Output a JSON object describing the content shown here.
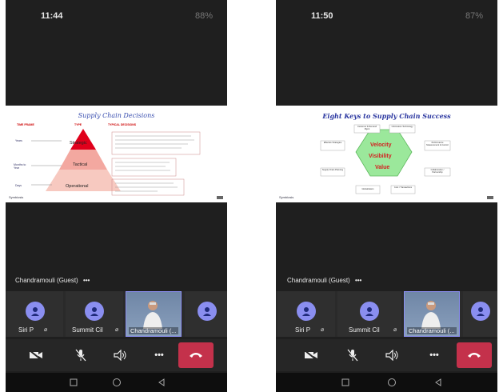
{
  "left": {
    "status": {
      "time": "11:44",
      "battery": "88%"
    },
    "slide": {
      "title": "Supply Chain Decisions",
      "headers": [
        "TIME FRAME",
        "TYPE",
        "TYPICAL DECISIONS"
      ],
      "time_frames": [
        "Years",
        "Months to Year",
        "Days"
      ],
      "tiers": [
        "Strategic",
        "Tactical",
        "Operational"
      ],
      "logo": "Symbiosis"
    },
    "caption": "Chandramouli (Guest)",
    "more_glyph": "•••",
    "participants": [
      {
        "name": "Siri P"
      },
      {
        "name": "Summit Cil"
      },
      {
        "name": "Chandramouli (..."
      }
    ]
  },
  "right": {
    "status": {
      "time": "11:50",
      "battery": "87%"
    },
    "slide": {
      "title": "Eight Keys to Supply Chain Success",
      "center": [
        "Velocity",
        "Visibility",
        "Value"
      ],
      "keys": [
        "Customer & Demand Mgmt",
        "Information Technology",
        "Performance Measurement & Control",
        "Collaboration / Partnership",
        "Cost / Transactions",
        "Globalization",
        "Supply Chain Planning",
        "Effective Strategies"
      ],
      "logo": "Symbiosis"
    },
    "caption": "Chandramouli (Guest)",
    "more_glyph": "•••",
    "participants": [
      {
        "name": "Siri P"
      },
      {
        "name": "Summit Cil"
      },
      {
        "name": "Chandramouli (..."
      }
    ]
  },
  "toolbar": {
    "more_glyph": "•••"
  },
  "colors": {
    "accent": "#8a8ef0",
    "hangup": "#c4314b",
    "pyramid_top": "#e0001b",
    "hexagon": "#9be89b"
  }
}
